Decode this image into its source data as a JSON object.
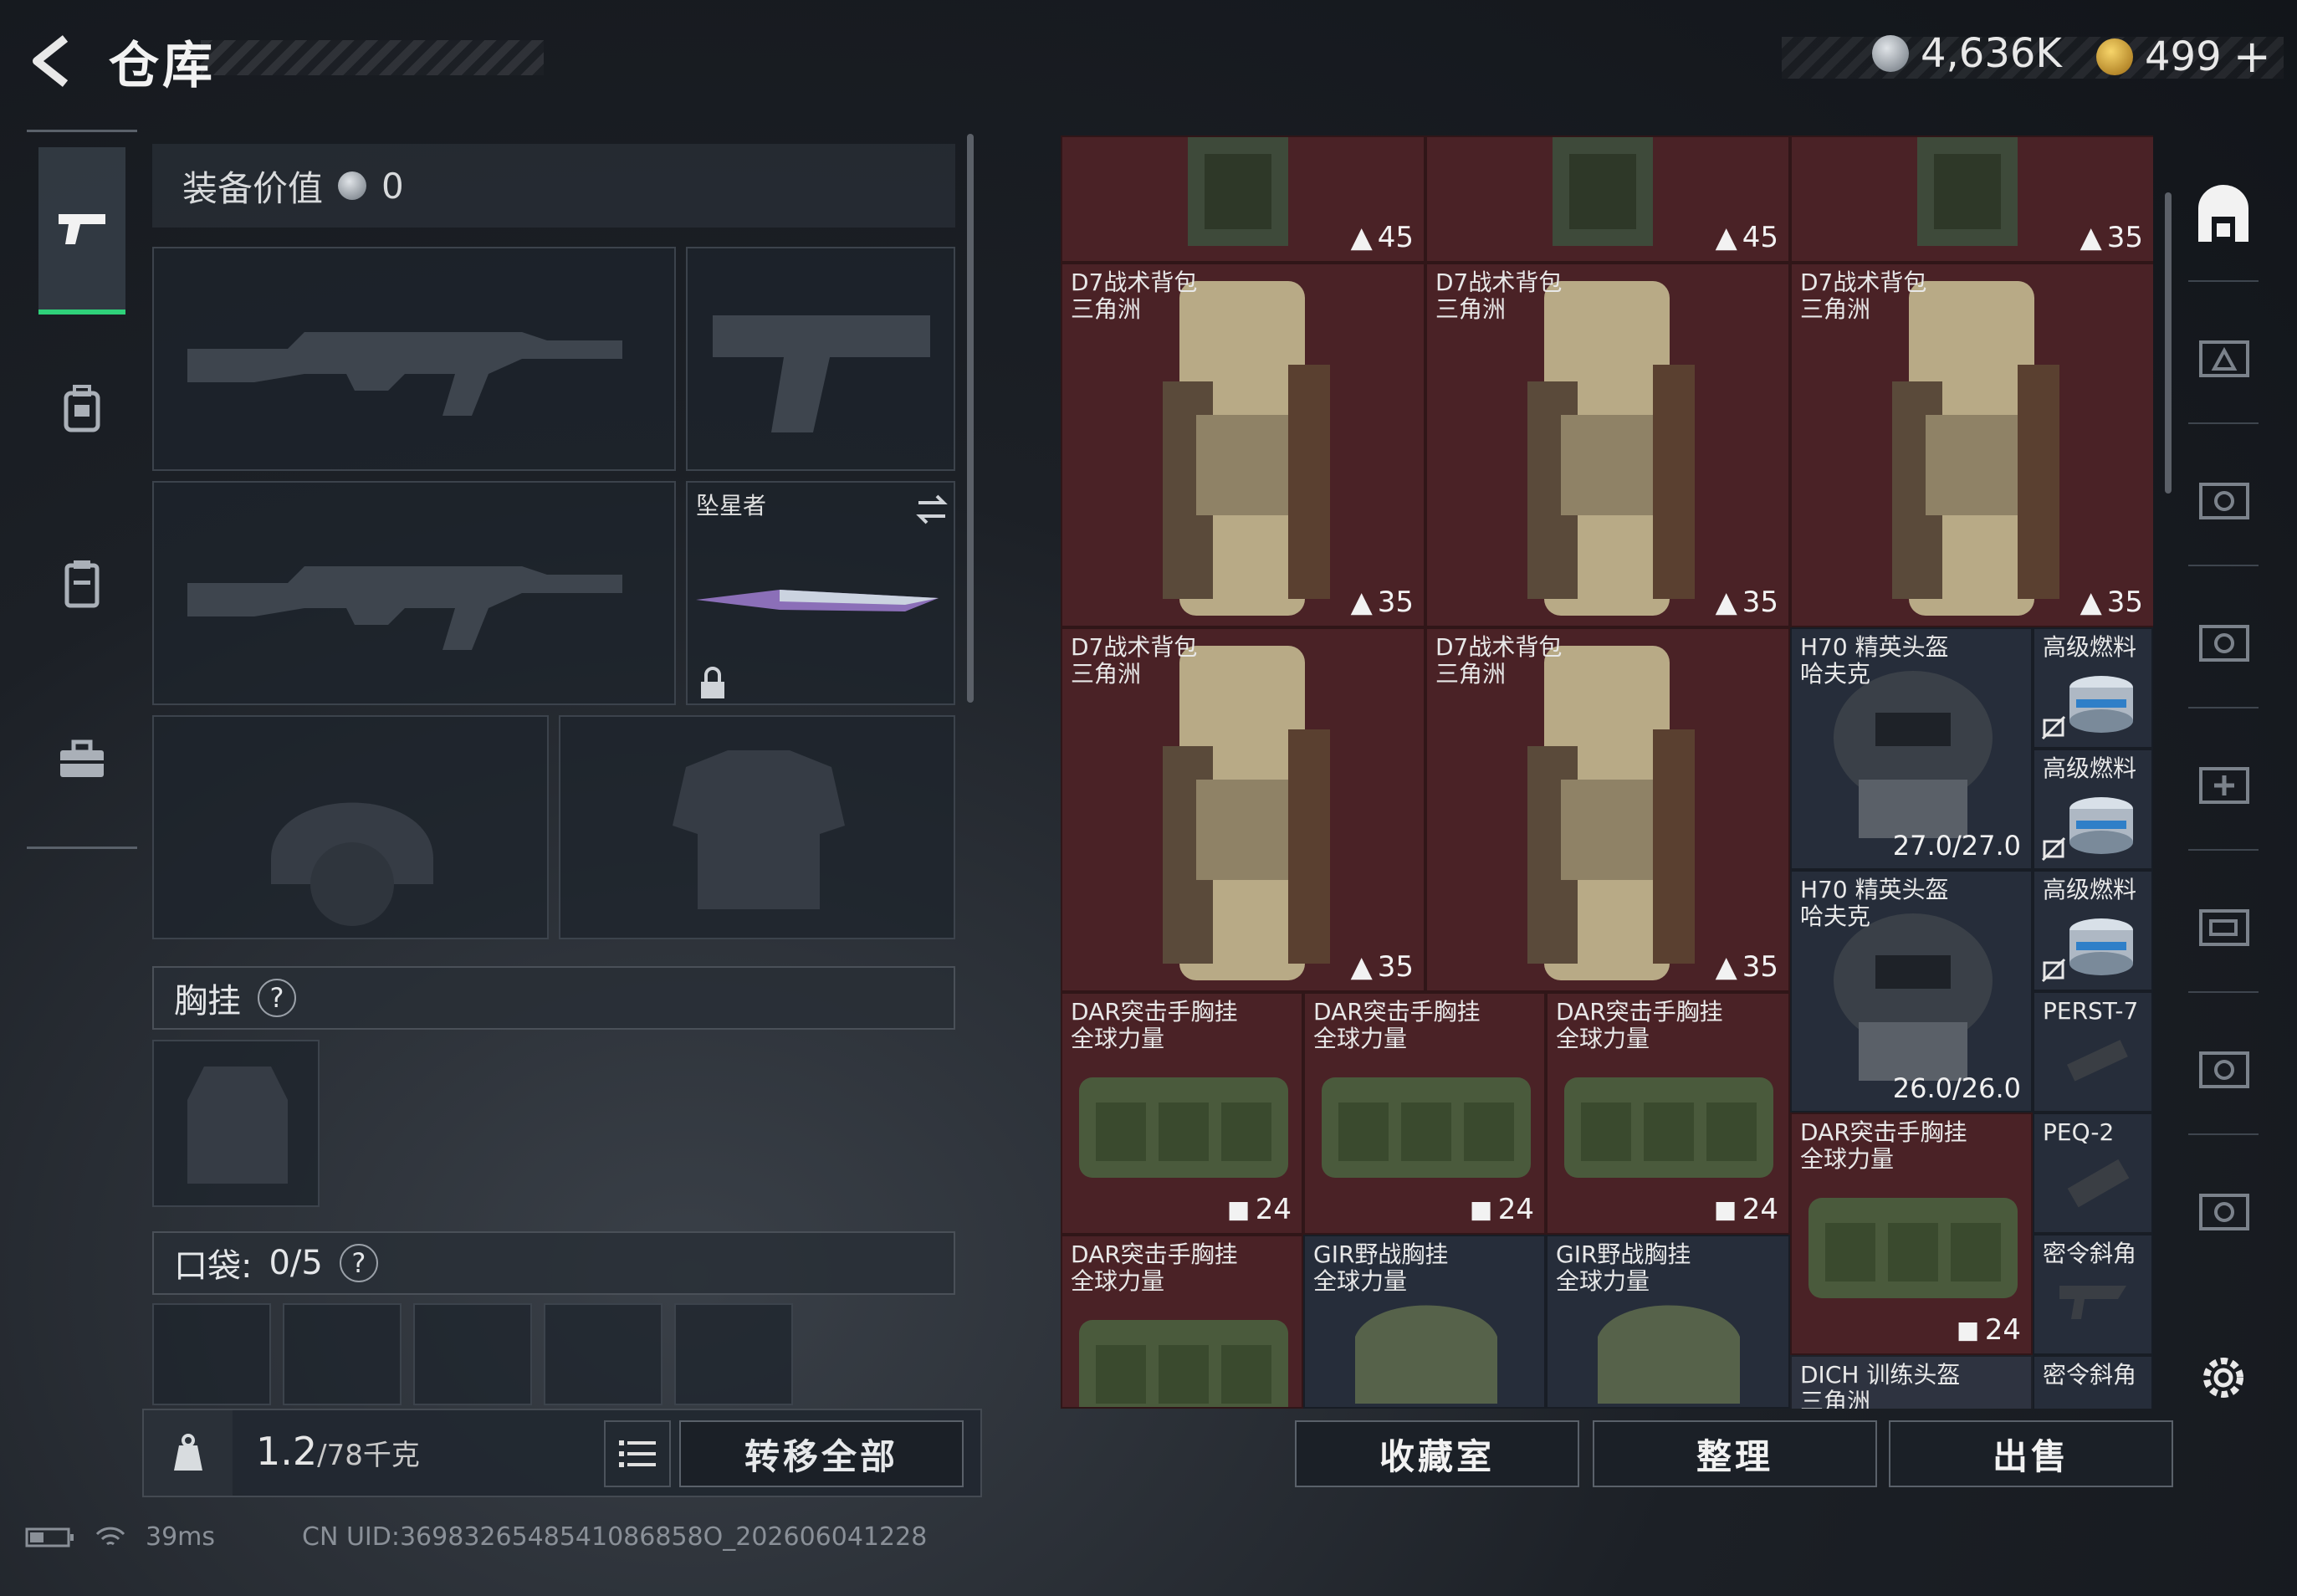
{
  "header": {
    "title": "仓库",
    "silver": "4,636K",
    "gold": "499",
    "gold_add": "+"
  },
  "equipment": {
    "value_label": "装备价值",
    "value": "0",
    "melee_name": "坠星者",
    "vest_label": "胸挂",
    "pocket_label": "口袋:",
    "pocket_count": "0/5",
    "help": "?"
  },
  "weight": {
    "current": "1.2",
    "max": "/78千克",
    "transfer_all": "转移全部"
  },
  "stash": {
    "top_tags": [
      "45",
      "45",
      "35"
    ],
    "backpacks": [
      {
        "name": "D7战术背包",
        "maker": "三角洲",
        "tag": "35"
      },
      {
        "name": "D7战术背包",
        "maker": "三角洲",
        "tag": "35"
      },
      {
        "name": "D7战术背包",
        "maker": "三角洲",
        "tag": "35"
      },
      {
        "name": "D7战术背包",
        "maker": "三角洲",
        "tag": "35"
      },
      {
        "name": "D7战术背包",
        "maker": "三角洲",
        "tag": "35"
      }
    ],
    "helmets": [
      {
        "name": "H70 精英头盔",
        "maker": "哈夫克",
        "durability": "27.0/27.0"
      },
      {
        "name": "H70 精英头盔",
        "maker": "哈夫克",
        "durability": "26.0/26.0"
      }
    ],
    "fuel": [
      {
        "name": "高级燃料"
      },
      {
        "name": "高级燃料"
      },
      {
        "name": "高级燃料"
      }
    ],
    "rigs": [
      {
        "name": "DAR突击手胸挂",
        "maker": "全球力量",
        "tag": "24"
      },
      {
        "name": "DAR突击手胸挂",
        "maker": "全球力量",
        "tag": "24"
      },
      {
        "name": "DAR突击手胸挂",
        "maker": "全球力量",
        "tag": "24"
      },
      {
        "name": "DAR突击手胸挂",
        "maker": "全球力量",
        "tag": "24"
      },
      {
        "name": "DAR突击手胸挂",
        "maker": "全球力量"
      },
      {
        "name": "GIR野战胸挂",
        "maker": "全球力量"
      },
      {
        "name": "GIR野战胸挂",
        "maker": "全球力量"
      }
    ],
    "attachments": [
      {
        "name": "PERST-7"
      },
      {
        "name": "PEQ-2"
      },
      {
        "name": "密令斜角"
      },
      {
        "name": "密令斜角"
      }
    ],
    "partial": {
      "name": "DICH 训练头盔",
      "maker": "三角洲"
    }
  },
  "actions": {
    "collection": "收藏室",
    "sort": "整理",
    "sell": "出售"
  },
  "footer": {
    "ping": "39ms",
    "uid": "CN UID:3698326548541086858O_202606041228"
  },
  "colors": {
    "accent": "#2fd17a",
    "item_red": "#4a2226",
    "item_blue": "#262d3a"
  }
}
